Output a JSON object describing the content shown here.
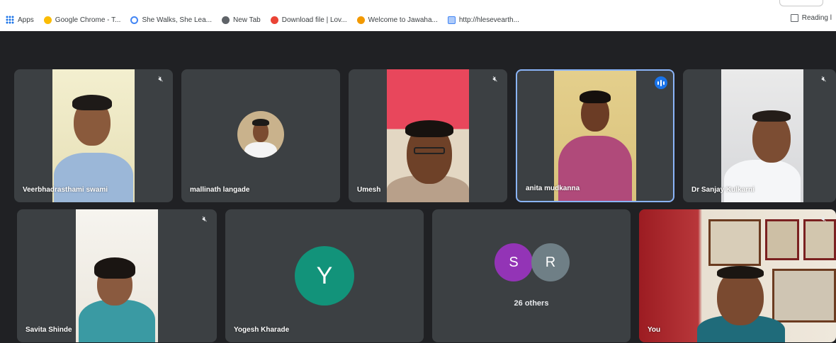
{
  "bookmarks": [
    {
      "label": "Apps",
      "color": "#1a73e8"
    },
    {
      "label": "Google Chrome - T...",
      "color": "#fbbc04"
    },
    {
      "label": "She Walks, She Lea...",
      "color": "#4285f4"
    },
    {
      "label": "New Tab",
      "color": "#5f6368"
    },
    {
      "label": "Download file | Lov...",
      "color": "#ea4335"
    },
    {
      "label": "Welcome to Jawaha...",
      "color": "#f29900"
    },
    {
      "label": "http://hlesevearth...",
      "color": "#4285f4"
    }
  ],
  "reading_list": "Reading l",
  "participants": [
    {
      "name": "Veerbhadrasthami swami",
      "muted": true
    },
    {
      "name": "mallinath langade",
      "muted": false
    },
    {
      "name": "Umesh",
      "muted": true
    },
    {
      "name": "anita mudkanna",
      "muted": false,
      "speaking": true
    },
    {
      "name": "Dr Sanjay Kulkarni",
      "muted": true
    },
    {
      "name": "Savita Shinde",
      "muted": true
    },
    {
      "name": "Yogesh Kharade",
      "muted": false,
      "initial": "Y",
      "avatar_color": "#12937a"
    },
    {
      "name": "You",
      "muted": true
    }
  ],
  "others": {
    "avatars": [
      {
        "initial": "S",
        "color": "#9334b6"
      },
      {
        "initial": "R",
        "color": "#6f7f86"
      }
    ],
    "count_label": "26 others"
  }
}
